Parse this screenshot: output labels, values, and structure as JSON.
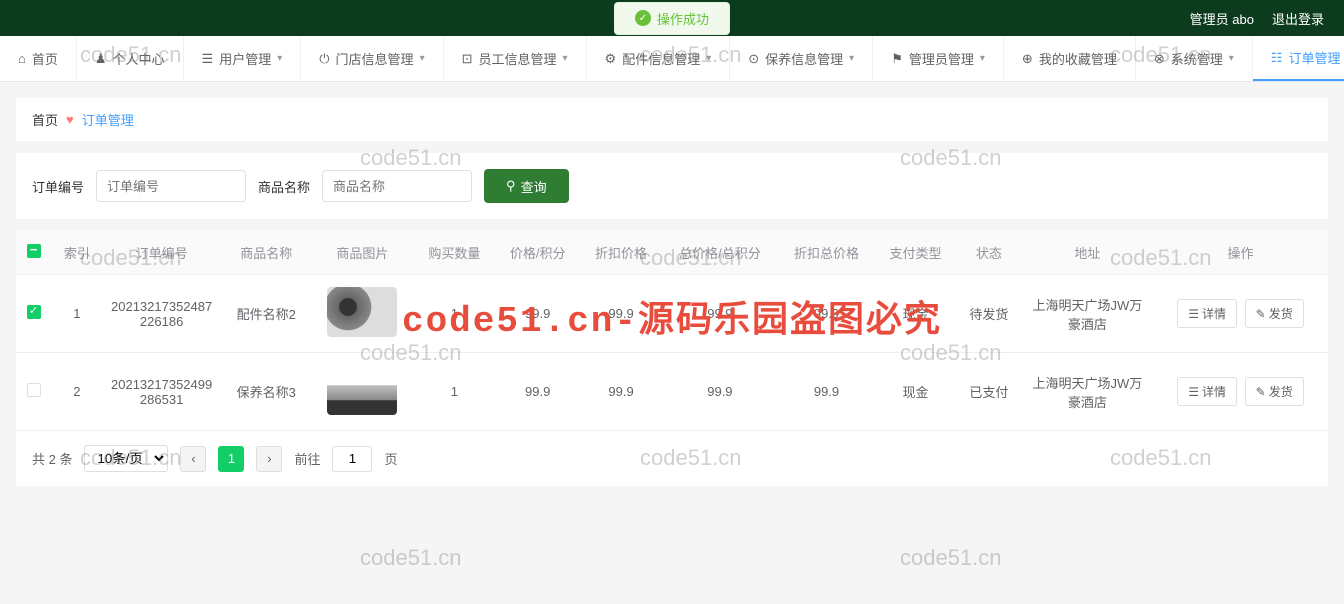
{
  "topBar": {
    "successMsg": "操作成功",
    "adminLabel": "管理员 abo",
    "logoutLabel": "退出登录"
  },
  "nav": {
    "items": [
      {
        "label": "首页",
        "hasChevron": false
      },
      {
        "label": "个人中心",
        "hasChevron": false
      },
      {
        "label": "用户管理",
        "hasChevron": true
      },
      {
        "label": "门店信息管理",
        "hasChevron": true
      },
      {
        "label": "员工信息管理",
        "hasChevron": true
      },
      {
        "label": "配件信息管理",
        "hasChevron": true
      },
      {
        "label": "保养信息管理",
        "hasChevron": true
      },
      {
        "label": "管理员管理",
        "hasChevron": true
      },
      {
        "label": "我的收藏管理",
        "hasChevron": false
      },
      {
        "label": "系统管理",
        "hasChevron": true
      },
      {
        "label": "订单管理",
        "hasChevron": true
      }
    ]
  },
  "breadcrumb": {
    "home": "首页",
    "current": "订单管理"
  },
  "search": {
    "orderLabel": "订单编号",
    "orderPlaceholder": "订单编号",
    "productLabel": "商品名称",
    "productPlaceholder": "商品名称",
    "queryBtn": "查询"
  },
  "table": {
    "headers": [
      "索引",
      "订单编号",
      "商品名称",
      "商品图片",
      "购买数量",
      "价格/积分",
      "折扣价格",
      "总价格/总积分",
      "折扣总价格",
      "支付类型",
      "状态",
      "地址",
      "操作"
    ],
    "rows": [
      {
        "index": "1",
        "orderNo": "20213217352487226186",
        "productName": "配件名称2",
        "qty": "1",
        "price": "99.9",
        "discount": "99.9",
        "total": "99.9",
        "discountTotal": "99.9",
        "payType": "现金",
        "status": "待发货",
        "address": "上海明天广场JW万豪酒店",
        "checked": true
      },
      {
        "index": "2",
        "orderNo": "20213217352499286531",
        "productName": "保养名称3",
        "qty": "1",
        "price": "99.9",
        "discount": "99.9",
        "total": "99.9",
        "discountTotal": "99.9",
        "payType": "现金",
        "status": "已支付",
        "address": "上海明天广场JW万豪酒店",
        "checked": false
      }
    ],
    "actions": {
      "detail": "详情",
      "ship": "发货"
    }
  },
  "pagination": {
    "total": "共 2 条",
    "perPage": "10条/页",
    "gotoLabel": "前往",
    "gotoValue": "1",
    "pageUnit": "页",
    "currentPage": "1"
  },
  "watermarkText": "code51.cn",
  "bigWatermark": "code51.cn-源码乐园盗图必究"
}
